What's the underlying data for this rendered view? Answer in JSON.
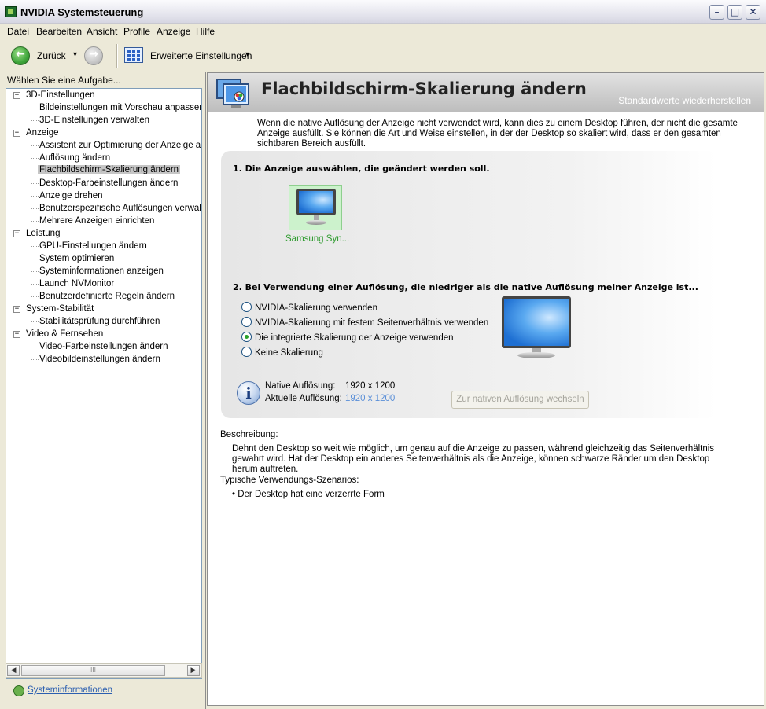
{
  "window": {
    "title": "NVIDIA Systemsteuerung"
  },
  "window_controls": {
    "minimize": "–",
    "maximize": "□",
    "close": "✕"
  },
  "menu": [
    "Datei",
    "Bearbeiten",
    "Ansicht",
    "Profile",
    "Anzeige",
    "Hilfe"
  ],
  "toolbar": {
    "back_label": "Zurück",
    "dropdown_glyph": "▾",
    "advanced_label": "Erweiterte Einstellungen"
  },
  "sidebar": {
    "title": "Wählen Sie eine Aufgabe...",
    "categories": [
      {
        "label": "3D-Einstellungen",
        "items": [
          "Bildeinstellungen mit Vorschau anpassen",
          "3D-Einstellungen verwalten"
        ]
      },
      {
        "label": "Anzeige",
        "items": [
          "Assistent zur Optimierung der Anzeige ausf",
          "Auflösung ändern",
          "Flachbildschirm-Skalierung ändern",
          "Desktop-Farbeinstellungen ändern",
          "Anzeige drehen",
          "Benutzerspezifische Auflösungen verwalten",
          "Mehrere Anzeigen einrichten"
        ]
      },
      {
        "label": "Leistung",
        "items": [
          "GPU-Einstellungen ändern",
          "System optimieren",
          "Systeminformationen anzeigen",
          "Launch NVMonitor",
          "Benutzerdefinierte Regeln ändern"
        ]
      },
      {
        "label": "System-Stabilität",
        "items": [
          "Stabilitätsprüfung durchführen"
        ]
      },
      {
        "label": "Video & Fernsehen",
        "items": [
          "Video-Farbeinstellungen ändern",
          "Videobildeinstellungen ändern"
        ]
      }
    ],
    "selected_item": "Flachbildschirm-Skalierung ändern",
    "scroll_grip": "III",
    "footer_link": "Systeminformationen"
  },
  "page": {
    "title": "Flachbildschirm-Skalierung ändern",
    "restore_link": "Standardwerte wiederherstellen",
    "intro": "Wenn die native Auflösung der Anzeige nicht verwendet wird, kann dies zu einem Desktop führen, der nicht die gesamte Anzeige ausfüllt. Sie können die Art und Weise einstellen, in der der Desktop so skaliert wird, dass er den gesamten sichtbaren Bereich ausfüllt.",
    "step1": "1. Die Anzeige auswählen, die geändert werden soll.",
    "display_name": "Samsung Syn...",
    "step2": "2. Bei Verwendung einer Auflösung, die niedriger als die native Auflösung meiner Anzeige ist...",
    "options": [
      {
        "label": "NVIDIA-Skalierung verwenden",
        "selected": false
      },
      {
        "label": "NVIDIA-Skalierung mit festem Seitenverhältnis verwenden",
        "selected": false
      },
      {
        "label": "Die integrierte Skalierung der Anzeige verwenden",
        "selected": true
      },
      {
        "label": "Keine Skalierung",
        "selected": false
      }
    ],
    "native_label": "Native Auflösung:",
    "native_value": "1920 x 1200",
    "current_label": "Aktuelle Auflösung:",
    "current_value": "1920 x 1200",
    "native_button": "Zur nativen Auflösung wechseln",
    "description_label": "Beschreibung:",
    "description": "Dehnt den Desktop so weit wie möglich, um genau auf die Anzeige zu passen, während gleichzeitig das Seitenverhältnis gewahrt wird. Hat der Desktop ein anderes Seitenverhältnis als die Anzeige, können schwarze Ränder um den Desktop herum auftreten.",
    "scenarios_label": "Typische Verwendungs-Szenarios:",
    "scenarios": [
      "Der Desktop hat eine verzerrte Form"
    ]
  },
  "colors": {
    "accent_green": "#2e9b2e",
    "link_blue": "#2c5fb0",
    "header_gray": "#bdbdbd"
  }
}
